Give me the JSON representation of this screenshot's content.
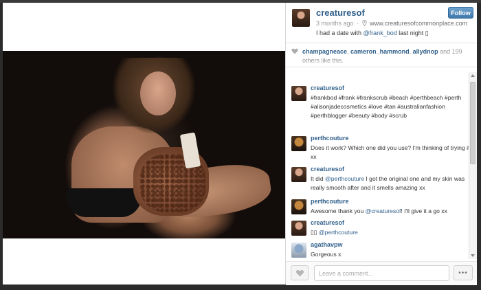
{
  "post": {
    "username": "creaturesof",
    "time_ago": "3 months ago",
    "separator": "·",
    "website": "www.creaturesofcommonplace.com",
    "caption_before": "I had a date with ",
    "caption_mention": "@frank_bod",
    "caption_after": " last night ▯",
    "follow_label": "Follow"
  },
  "likes": {
    "names": [
      "champagneace",
      "cameron_hammond",
      "allydnop"
    ],
    "and_text": " and ",
    "others_count": "199",
    "suffix": " others like this."
  },
  "comments": [
    {
      "user": "creaturesof",
      "avatar": "creaturesof-avatar",
      "parts": [
        {
          "t": "#frankbod #frank #frankscrub #beach #perthbeach #perth #alisonjadecosmetics #love #tan #australianfashion #perthblogger #beauty #body #scrub"
        }
      ]
    },
    {
      "user": "perthcouture",
      "avatar": "perthcouture-avatar",
      "parts": [
        {
          "t": "Does it work? Which one did you use? I'm thinking of trying it xx"
        }
      ]
    },
    {
      "user": "creaturesof",
      "avatar": "creaturesof-avatar",
      "parts": [
        {
          "t": "It did "
        },
        {
          "m": "@perthcouture"
        },
        {
          "t": " I got the original one and my skin was really smooth after and it smells amazing xx"
        }
      ]
    },
    {
      "user": "perthcouture",
      "avatar": "perthcouture-avatar",
      "parts": [
        {
          "t": "Awesome thank you "
        },
        {
          "m": "@creaturesof"
        },
        {
          "t": "! I'll give it a go xx"
        }
      ]
    },
    {
      "user": "creaturesof",
      "avatar": "creaturesof-avatar",
      "parts": [
        {
          "t": "▯▯ "
        },
        {
          "m": "@perthcouture"
        }
      ]
    },
    {
      "user": "agathavpw",
      "avatar": "agathavpw-avatar",
      "parts": [
        {
          "t": "Gorgeous x"
        }
      ]
    }
  ],
  "footer": {
    "comment_placeholder": "Leave a comment...",
    "more_label": "•••"
  },
  "icons": {
    "heart": "heart-icon",
    "location": "location-pin-icon",
    "more": "more-options-icon"
  },
  "colors": {
    "link_blue": "#2f5f8a",
    "follow_blue": "#3d78ab",
    "muted_gray": "#999999",
    "page_bg": "#2b2b2b"
  }
}
